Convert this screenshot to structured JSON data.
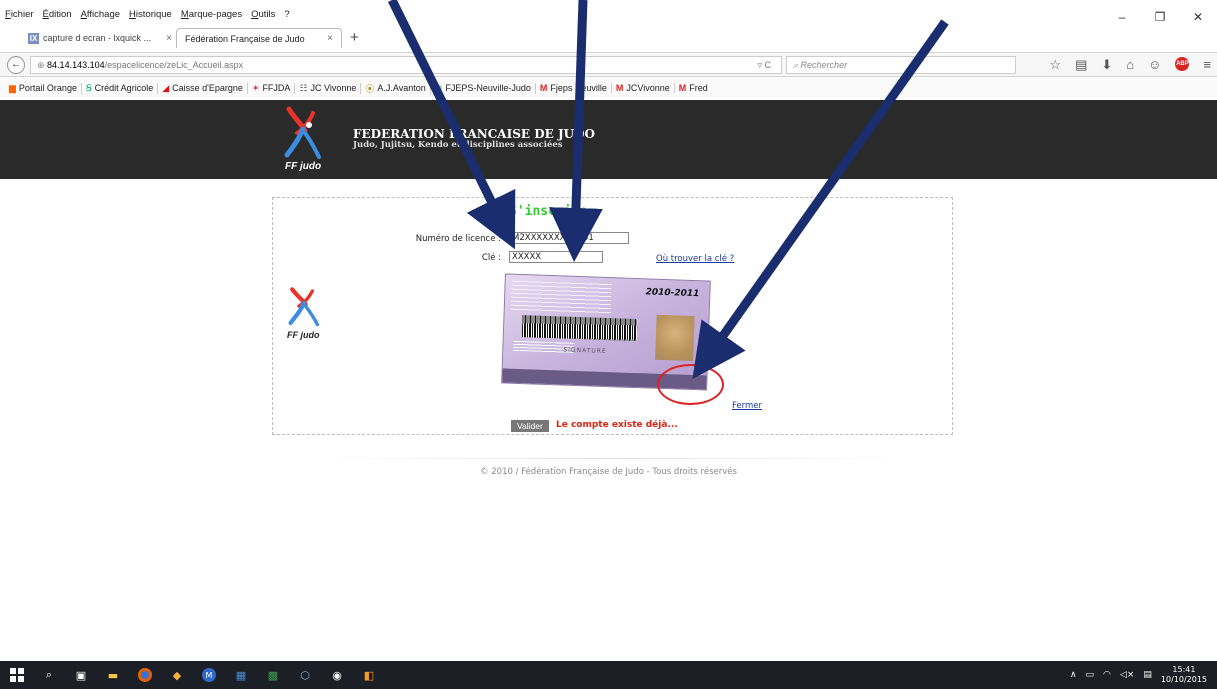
{
  "menubar": {
    "items": [
      "Fichier",
      "Édition",
      "Affichage",
      "Historique",
      "Marque-pages",
      "Outils",
      "?"
    ]
  },
  "window_controls": {
    "minimize": "–",
    "restore": "❐",
    "close": "✕"
  },
  "tabs": [
    {
      "label": "capture d ecran - lxquick ...",
      "favicon": "IX"
    },
    {
      "label": "Fédération Française de Judo"
    }
  ],
  "tab_close": "×",
  "new_tab": "+",
  "navbar": {
    "back": "←",
    "url_host": "84.14.143.104",
    "url_path": "/espacelicence/zeLic_Accueil.aspx",
    "reload": "▿ C",
    "search_placeholder": "Rechercher"
  },
  "bookmarks": [
    {
      "label": "Portail Orange",
      "icon": "▆"
    },
    {
      "label": "Crédit Agricole",
      "icon": "Ꞩ"
    },
    {
      "label": "Caisse d'Epargne",
      "icon": "◢"
    },
    {
      "label": "FFJDA",
      "icon": "✶"
    },
    {
      "label": "JC Vivonne",
      "icon": "☷"
    },
    {
      "label": "A.J.Avanton",
      "icon": "⦿"
    },
    {
      "label": "FJEPS-Neuville-Judo",
      "icon": "⊘"
    },
    {
      "label": "Fjeps Neuville",
      "icon": "M"
    },
    {
      "label": "JCVivonne",
      "icon": "M"
    },
    {
      "label": "Fred",
      "icon": "M"
    }
  ],
  "site": {
    "title": "FEDERATION FRANCAISE DE JUDO",
    "subtitle": "Judo, Jujitsu, Kendo et disciplines associées",
    "logo_text": "FF judo"
  },
  "form": {
    "title": "S'inscrire",
    "licence_label": "Numéro de licence :",
    "licence_value": "M2XXXXXXXXXX01",
    "cle_label": "Clé :",
    "cle_value": "XXXXX",
    "find_key_link": "Où trouver la clé ?",
    "card_year": "2010-2011",
    "card_signature": "SIGNATURE",
    "close_link": "Fermer",
    "submit": "Valider",
    "message": "Le compte existe déjà..."
  },
  "footer": "© 2010 / Fédération Française de Judo - Tous droits réservés",
  "taskbar": {
    "icons": [
      "windows-start-icon",
      "search-icon",
      "store-icon",
      "file-explorer-icon",
      "firefox-icon",
      "paint-icon",
      "maxthon-icon",
      "app-icon",
      "excel-icon",
      "network-icon",
      "media-icon",
      "app2-icon"
    ],
    "clock_time": "15:41",
    "clock_date": "10/10/2015"
  },
  "colors": {
    "header_bg": "#2a2a2a",
    "title_green": "#33cc33",
    "error_red": "#dd2211",
    "arrow_navy": "#1a2d6e"
  }
}
